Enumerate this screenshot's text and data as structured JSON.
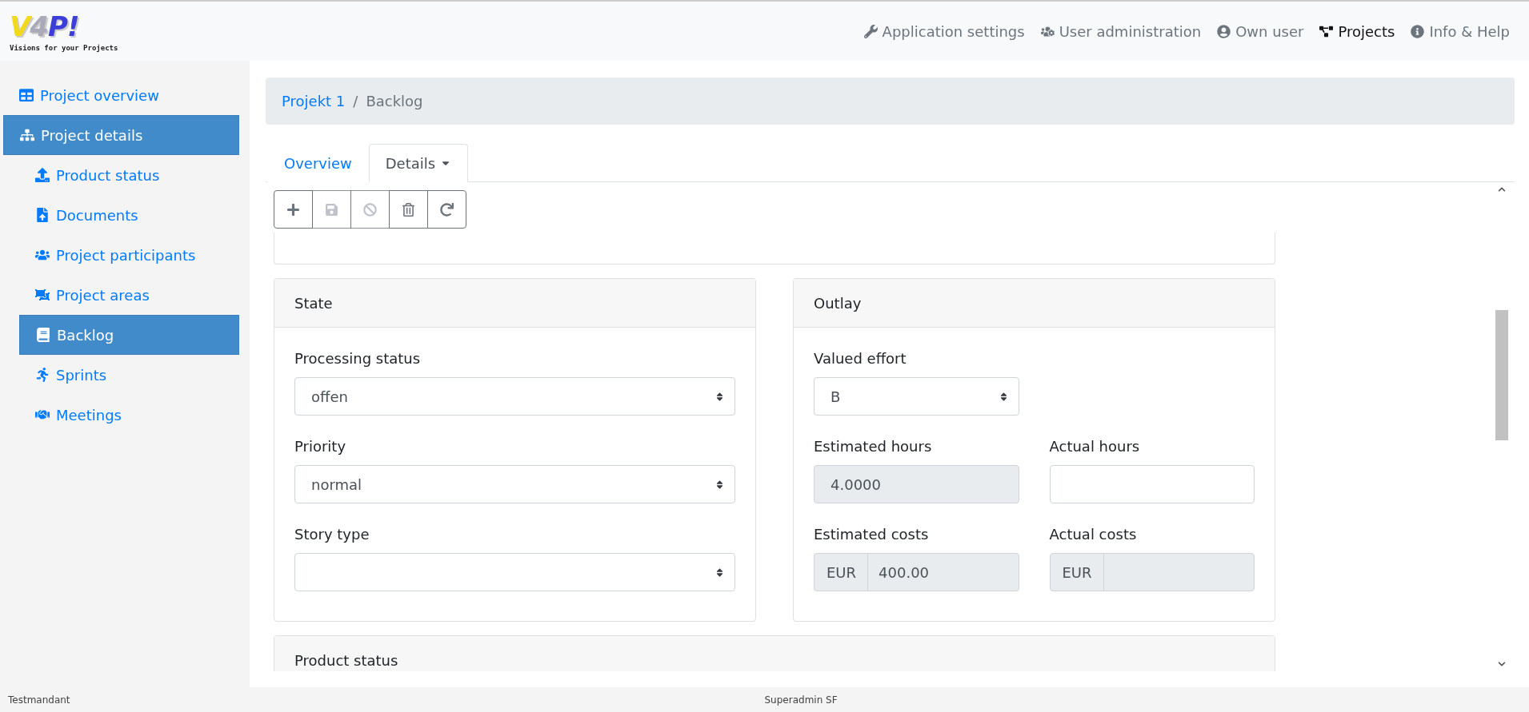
{
  "logo": {
    "mark": "V4P!",
    "tagline": "Visions for your Projects"
  },
  "top_nav": [
    {
      "label": "Application settings",
      "selected": false
    },
    {
      "label": "User administration",
      "selected": false
    },
    {
      "label": "Own user",
      "selected": false
    },
    {
      "label": "Projects",
      "selected": true
    },
    {
      "label": "Info & Help",
      "selected": false
    }
  ],
  "sidebar": {
    "items": [
      {
        "label": "Project overview",
        "selected": false
      },
      {
        "label": "Project details",
        "selected": true,
        "children": [
          {
            "label": "Product status",
            "selected": false
          },
          {
            "label": "Documents",
            "selected": false
          },
          {
            "label": "Project participants",
            "selected": false
          },
          {
            "label": "Project areas",
            "selected": false
          },
          {
            "label": "Backlog",
            "selected": true
          },
          {
            "label": "Sprints",
            "selected": false
          },
          {
            "label": "Meetings",
            "selected": false
          }
        ]
      }
    ]
  },
  "breadcrumb": {
    "items": [
      "Projekt 1",
      "Backlog"
    ],
    "separator": "/"
  },
  "tabs": [
    {
      "label": "Overview",
      "selected": false,
      "kind": "link"
    },
    {
      "label": "Details",
      "selected": true,
      "kind": "dropdown"
    }
  ],
  "toolbar": [
    {
      "disabled": false
    },
    {
      "disabled": true
    },
    {
      "disabled": true
    },
    {
      "disabled": false
    },
    {
      "disabled": false
    }
  ],
  "state_card": {
    "title": "State",
    "fields": [
      {
        "label": "Processing status",
        "kind": "select",
        "value": "offen"
      },
      {
        "label": "Priority",
        "kind": "select",
        "value": "normal"
      },
      {
        "label": "Story type",
        "kind": "select"
      }
    ]
  },
  "outlay_card": {
    "title": "Outlay",
    "rows": [
      [
        {
          "label": "Valued effort",
          "kind": "select",
          "value": "B"
        }
      ],
      [
        {
          "label": "Estimated hours",
          "kind": "input",
          "disabled": true,
          "value": "4.0000"
        },
        {
          "label": "Actual hours",
          "kind": "input",
          "disabled": false
        }
      ],
      [
        {
          "label": "Estimated costs",
          "kind": "currency",
          "disabled": true,
          "prefix": "EUR",
          "value": "400.00"
        },
        {
          "label": "Actual costs",
          "kind": "currency",
          "disabled": true,
          "prefix": "EUR"
        }
      ]
    ]
  },
  "product_status_card": {
    "title": "Product status"
  },
  "footer": {
    "left": "Testmandant",
    "center": "Superadmin SF"
  }
}
